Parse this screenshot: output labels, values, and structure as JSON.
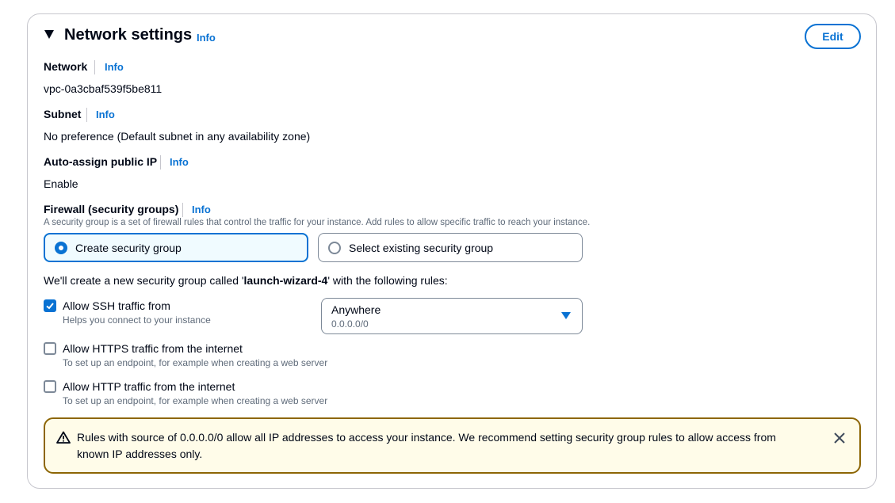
{
  "header": {
    "title": "Network settings",
    "info": "Info",
    "edit_label": "Edit"
  },
  "network": {
    "label": "Network",
    "info": "Info",
    "value": "vpc-0a3cbaf539f5be811"
  },
  "subnet": {
    "label": "Subnet",
    "info": "Info",
    "value": "No preference (Default subnet in any availability zone)"
  },
  "auto_assign": {
    "label": "Auto-assign public IP",
    "info": "Info",
    "value": "Enable"
  },
  "firewall": {
    "label": "Firewall (security groups)",
    "info": "Info",
    "description": "A security group is a set of firewall rules that control the traffic for your instance. Add rules to allow specific traffic to reach your instance.",
    "options": [
      {
        "label": "Create security group",
        "selected": true
      },
      {
        "label": "Select existing security group",
        "selected": false
      }
    ]
  },
  "rules_intro": {
    "prefix": "We'll create a new security group called '",
    "name": "launch-wizard-4",
    "suffix": "' with the following rules:"
  },
  "rules": [
    {
      "label": "Allow SSH traffic from",
      "description": "Helps you connect to your instance",
      "checked": true
    },
    {
      "label": "Allow HTTPS traffic from the internet",
      "description": "To set up an endpoint, for example when creating a web server",
      "checked": false
    },
    {
      "label": "Allow HTTP traffic from the internet",
      "description": "To set up an endpoint, for example when creating a web server",
      "checked": false
    }
  ],
  "ssh_source": {
    "value": "Anywhere",
    "description": "0.0.0.0/0"
  },
  "alert": {
    "line1": "Rules with source of 0.0.0.0/0 allow all IP addresses to access your instance. We recommend setting security group rules to allow access from",
    "line2": "known IP addresses only."
  },
  "colors": {
    "accent": "#0972d3",
    "warning_border": "#8d6605",
    "warning_bg": "#fffce9"
  },
  "icons": [
    "caret-down-icon",
    "radio-icon",
    "checkbox-icon",
    "dropdown-triangle-icon",
    "warning-icon",
    "close-icon"
  ]
}
